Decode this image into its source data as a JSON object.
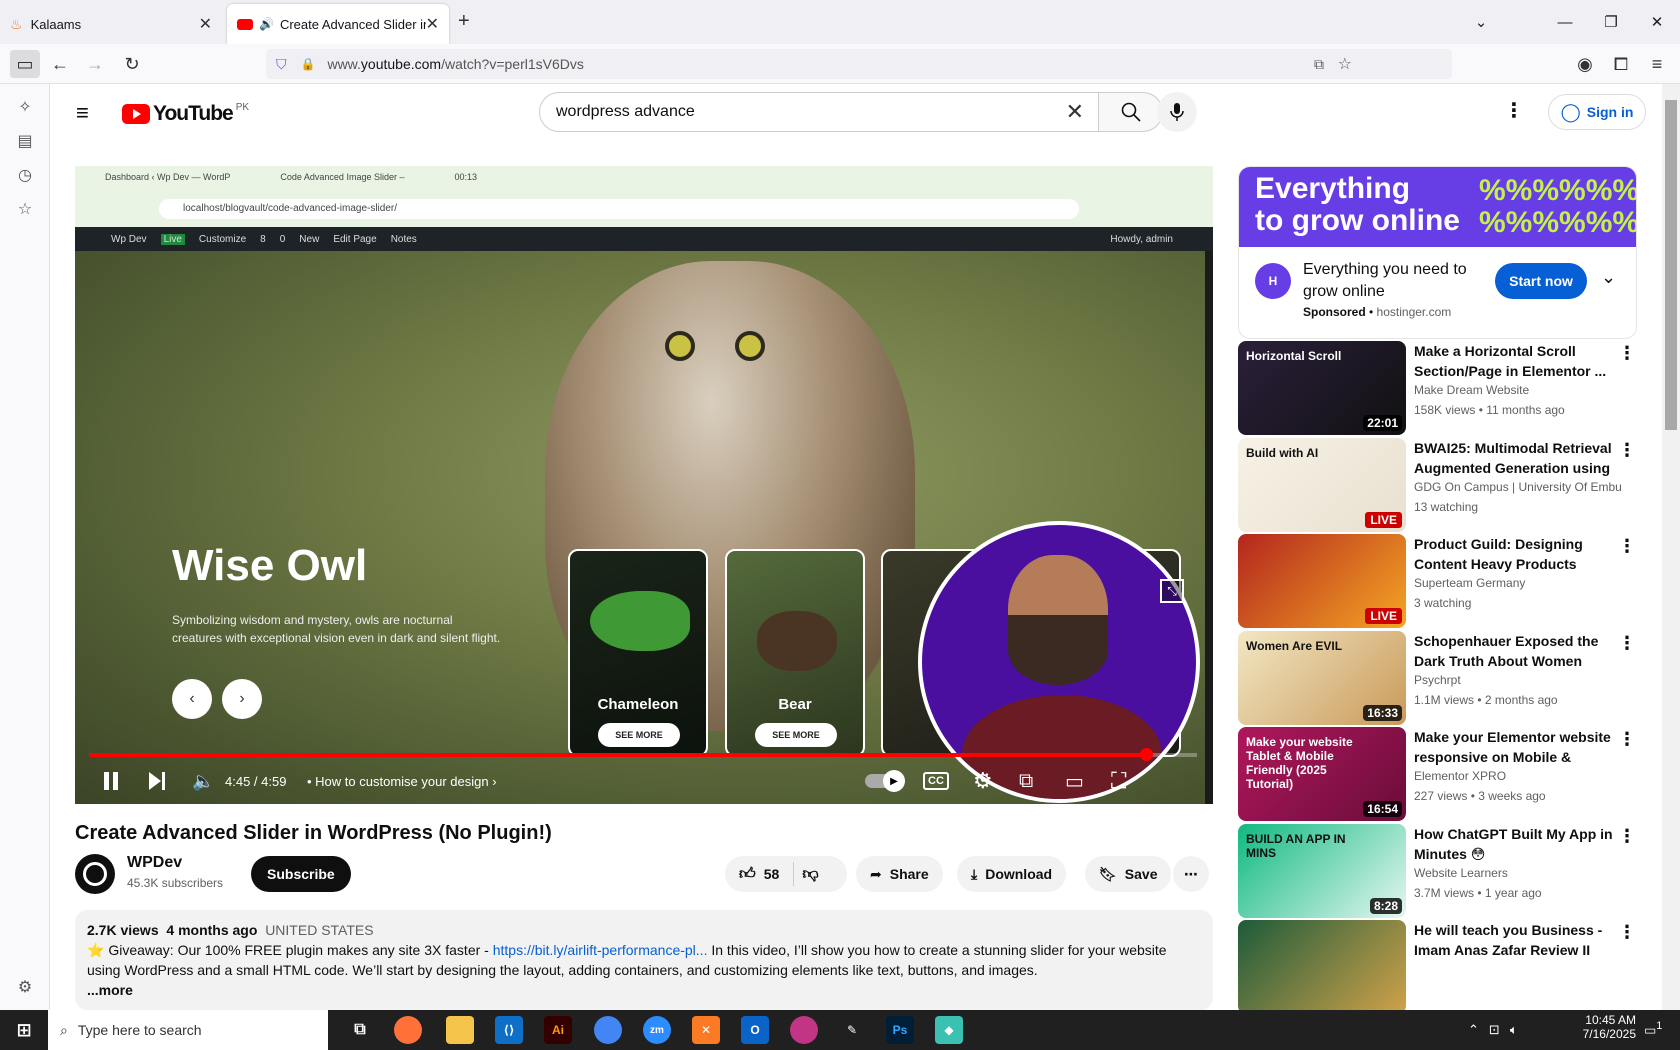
{
  "browser": {
    "tabs": [
      {
        "title": "Kalaams",
        "active": false
      },
      {
        "title": "Create Advanced Slider in W",
        "active": true
      }
    ],
    "new_tab_symbol": "+",
    "url_prefix": "www.",
    "url_domain": "youtube.com",
    "url_path": "/watch?v=perl1sV6Dvs"
  },
  "youtube": {
    "logo_text": "YouTube",
    "country": "PK",
    "search_value": "wordpress advance",
    "signin_label": "Sign in",
    "player": {
      "inner_tabs": [
        "Dashboard ‹ Wp Dev — WordP",
        "Code Advanced Image Slider –",
        "00:13"
      ],
      "inner_url": "localhost/blogvault/code-advanced-image-slider/",
      "wp_bar": [
        "Wp Dev",
        "Live",
        "Customize",
        "8",
        "0",
        "New",
        "Edit Page",
        "Notes"
      ],
      "wp_howdy": "Howdy, admin",
      "slider_title": "Wise Owl",
      "slider_desc": "Symbolizing wisdom and mystery, owls are nocturnal creatures with exceptional vision even in dark and silent flight.",
      "cards": [
        {
          "label": "Chameleon",
          "button": "SEE MORE"
        },
        {
          "label": "Bear",
          "button": "SEE MORE"
        }
      ],
      "time": "4:45 / 4:59",
      "chapter": "How to customise your design",
      "progress": 0.954
    },
    "video_title": "Create Advanced Slider in WordPress (No Plugin!)",
    "channel": {
      "name": "WPDev",
      "subscribers": "45.3K subscribers",
      "subscribe_label": "Subscribe"
    },
    "actions": {
      "likes": "58",
      "share": "Share",
      "download": "Download",
      "save": "Save"
    },
    "description": {
      "views": "2.7K views",
      "age": "4 months ago",
      "country": "UNITED STATES",
      "line1_pre": "⭐ Giveaway: Our 100% FREE plugin makes any site 3X faster  - ",
      "link": "https://bit.ly/airlift-performance-pl...",
      "line1_post": " In this video, I’ll show you how to create a stunning slider for your website",
      "line2": "using WordPress and a small HTML code. We’ll start by designing the layout, adding containers, and customizing elements like text, buttons, and images.",
      "more": "...more"
    },
    "ad": {
      "banner_line1": "Everything",
      "banner_line2": "to grow online",
      "banner_pattern": "%%%%%%%",
      "text": "Everything you need to grow online",
      "sponsored": "Sponsored",
      "domain": "hostinger.com",
      "cta": "Start now"
    },
    "recommendations": [
      {
        "title": "Make a Horizontal Scroll Section/Page in Elementor ...",
        "channel": "Make Dream Website",
        "meta": "158K views • 11 months ago",
        "badge": "22:01",
        "live": false
      },
      {
        "title": "BWAI25: Multimodal Retrieval Augmented Generation using ...",
        "channel": "GDG On Campus | University Of Embu",
        "meta": "13 watching",
        "badge": "LIVE",
        "live": true
      },
      {
        "title": "Product Guild: Designing Content Heavy Products",
        "channel": "Superteam Germany",
        "meta": "3 watching",
        "badge": "LIVE",
        "live": true
      },
      {
        "title": "Schopenhauer Exposed the Dark Truth About Women (Tha...",
        "channel": "Psychrpt",
        "meta": "1.1M views • 2 months ago",
        "badge": "16:33",
        "live": false
      },
      {
        "title": "Make your Elementor website responsive on Mobile & Tablet!...",
        "channel": "Elementor XPRO",
        "meta": "227 views • 3 weeks ago",
        "badge": "16:54",
        "live": false
      },
      {
        "title": "How ChatGPT Built My App in Minutes 😳",
        "channel": "Website Learners",
        "meta": "3.7M views • 1 year ago",
        "badge": "8:28",
        "live": false
      },
      {
        "title": "He will teach you Business - Imam Anas Zafar Review II",
        "channel": "",
        "meta": "",
        "badge": "",
        "live": false
      }
    ],
    "thumb_texts": [
      "Horizontal Scroll",
      "Build with AI",
      "",
      "Women Are EVIL",
      "Make your website Tablet & Mobile Friendly (2025 Tutorial)",
      "BUILD AN APP IN MINS",
      ""
    ]
  },
  "taskbar": {
    "search_placeholder": "Type here to search",
    "time": "10:45 AM",
    "date": "7/16/2025",
    "notifications": "1"
  },
  "colors": {
    "youtube_red": "#ff0000",
    "link_blue": "#065fd4",
    "hostinger_purple": "#673de6"
  }
}
